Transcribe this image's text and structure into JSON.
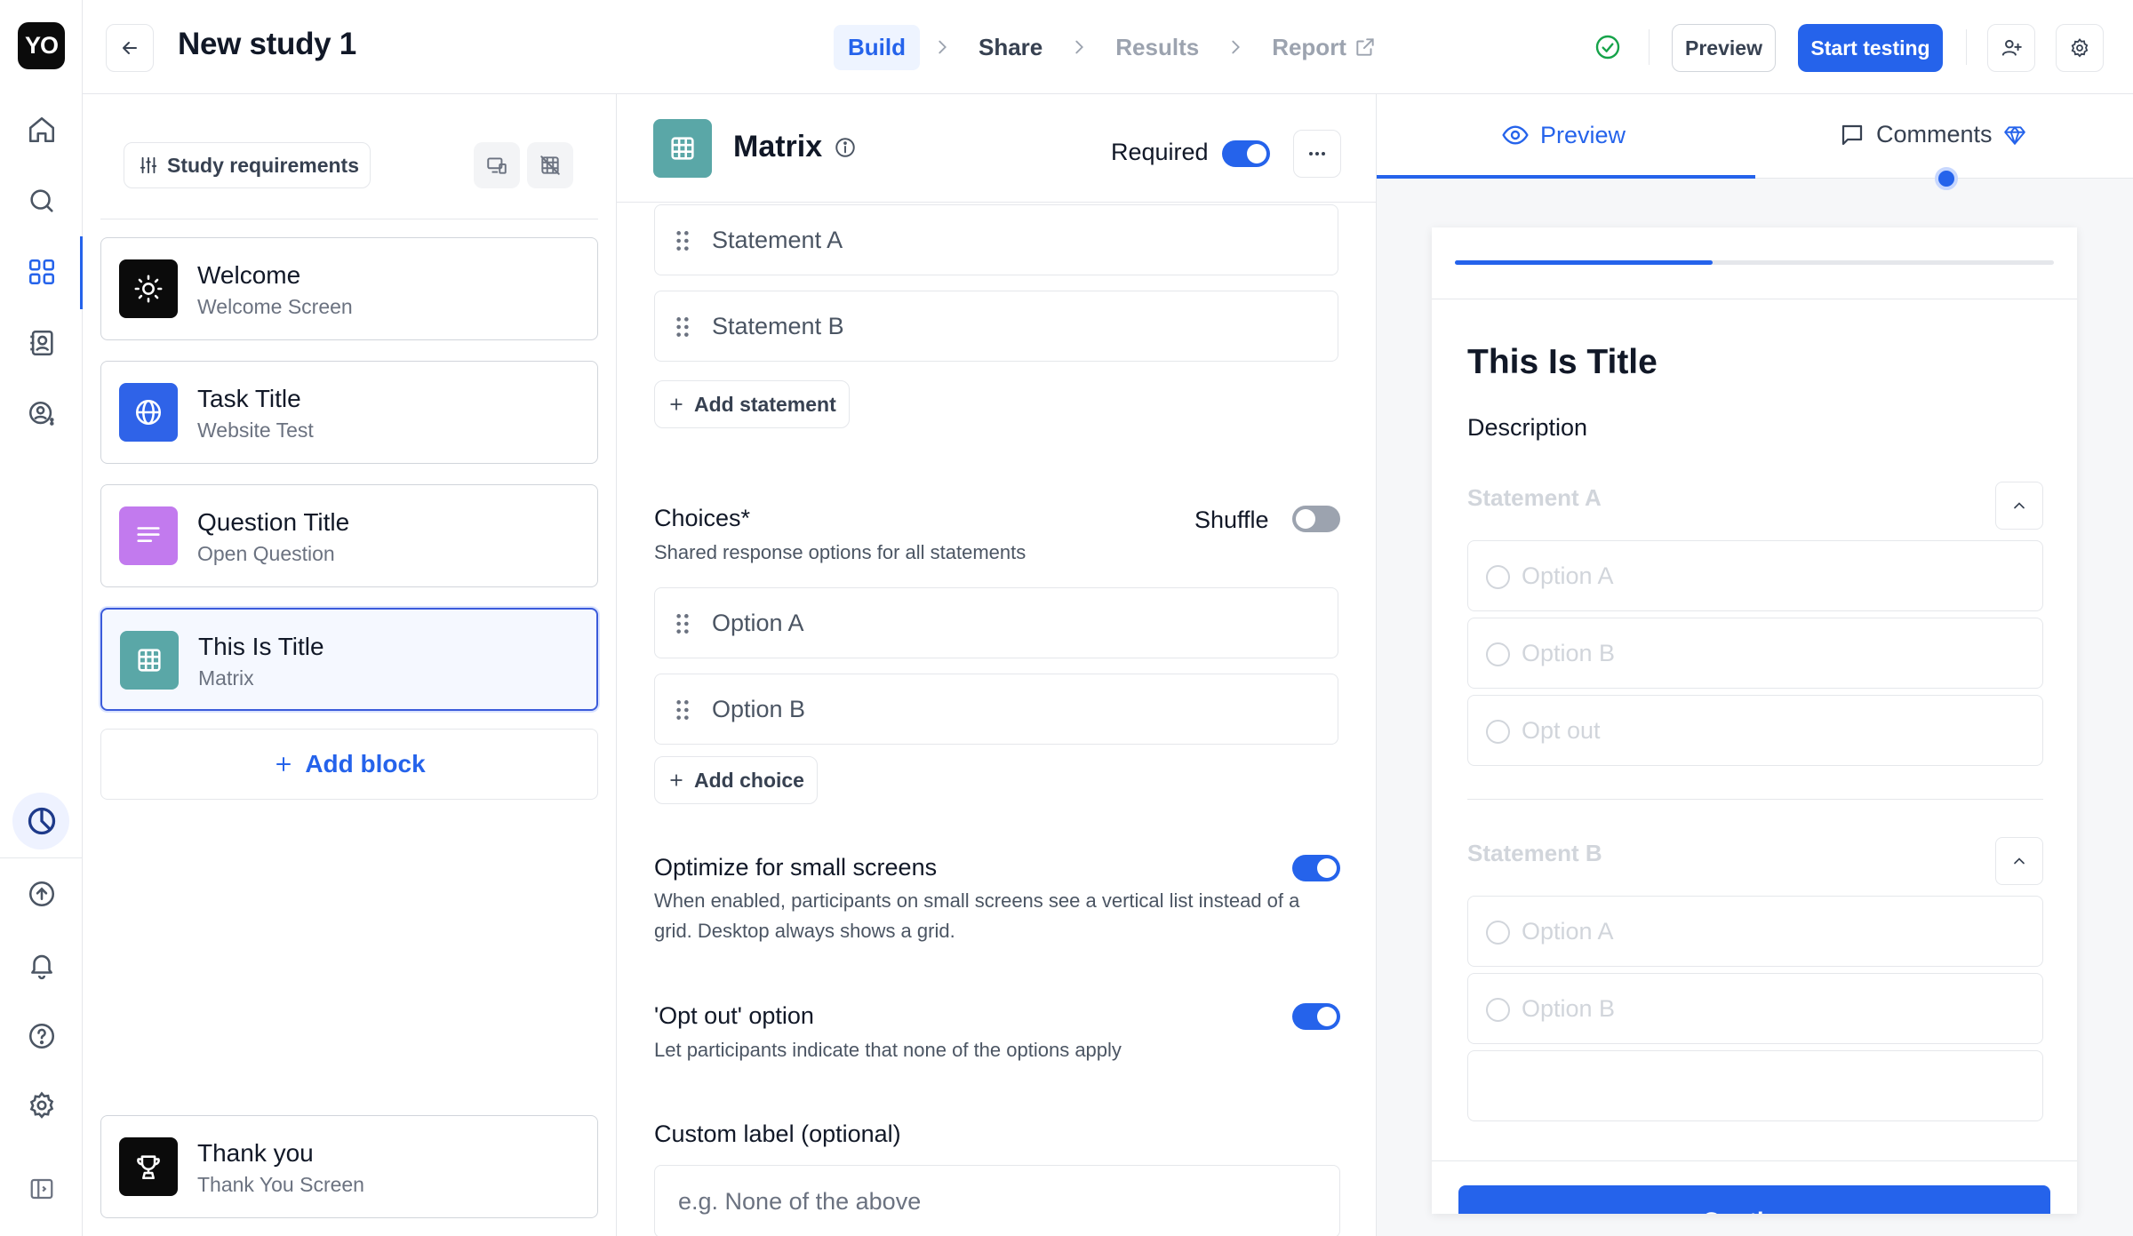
{
  "app": {
    "logo_text": "YO",
    "study_title": "New study 1"
  },
  "steps": [
    {
      "label": "Build",
      "state": "active"
    },
    {
      "label": "Share",
      "state": "normal"
    },
    {
      "label": "Results",
      "state": "disabled"
    },
    {
      "label": "Report",
      "state": "disabled"
    }
  ],
  "toolbar": {
    "preview_label": "Preview",
    "start_label": "Start testing"
  },
  "sidebar": {
    "requirements_label": "Study requirements",
    "blocks": [
      {
        "title": "Welcome",
        "subtitle": "Welcome Screen",
        "icon": "sun-icon",
        "color": "#0b0b0b"
      },
      {
        "title": "Task Title",
        "subtitle": "Website Test",
        "icon": "globe-icon",
        "color": "#2f63e8"
      },
      {
        "title": "Question Title",
        "subtitle": "Open Question",
        "icon": "text-lines-icon",
        "color": "#c27aee"
      },
      {
        "title": "This Is Title",
        "subtitle": "Matrix",
        "icon": "grid-icon",
        "color": "#5aa7a7"
      }
    ],
    "add_block_label": "Add block",
    "thank_you": {
      "title": "Thank you",
      "subtitle": "Thank You Screen",
      "icon": "trophy-icon",
      "color": "#0b0b0b"
    }
  },
  "editor": {
    "block_type": "Matrix",
    "required_label": "Required",
    "required_on": true,
    "statements": [
      "Statement A",
      "Statement B"
    ],
    "add_statement_label": "Add statement",
    "choices_label": "Choices*",
    "choices_desc": "Shared response options for all statements",
    "shuffle_label": "Shuffle",
    "shuffle_on": false,
    "choices": [
      "Option A",
      "Option B"
    ],
    "add_choice_label": "Add choice",
    "optimize_label": "Optimize for small screens",
    "optimize_desc": "When enabled, participants on small screens see a vertical list instead of a grid. Desktop always shows a grid.",
    "optimize_on": true,
    "optout_label": "'Opt out' option",
    "optout_desc": "Let participants indicate that none of the options apply",
    "optout_on": true,
    "custom_label": "Custom label (optional)",
    "custom_placeholder": "e.g. None of the above"
  },
  "preview": {
    "tab_preview": "Preview",
    "tab_comments": "Comments",
    "progress": 0.43,
    "title": "This Is Title",
    "description": "Description",
    "statement_a": "Statement A",
    "statement_b": "Statement B",
    "options_a": [
      "Option A",
      "Option B",
      "Opt out"
    ],
    "options_b": [
      "Option A",
      "Option B"
    ],
    "continue_label": "Continue"
  },
  "colors": {
    "accent": "#2563eb",
    "success": "#16a34a"
  }
}
